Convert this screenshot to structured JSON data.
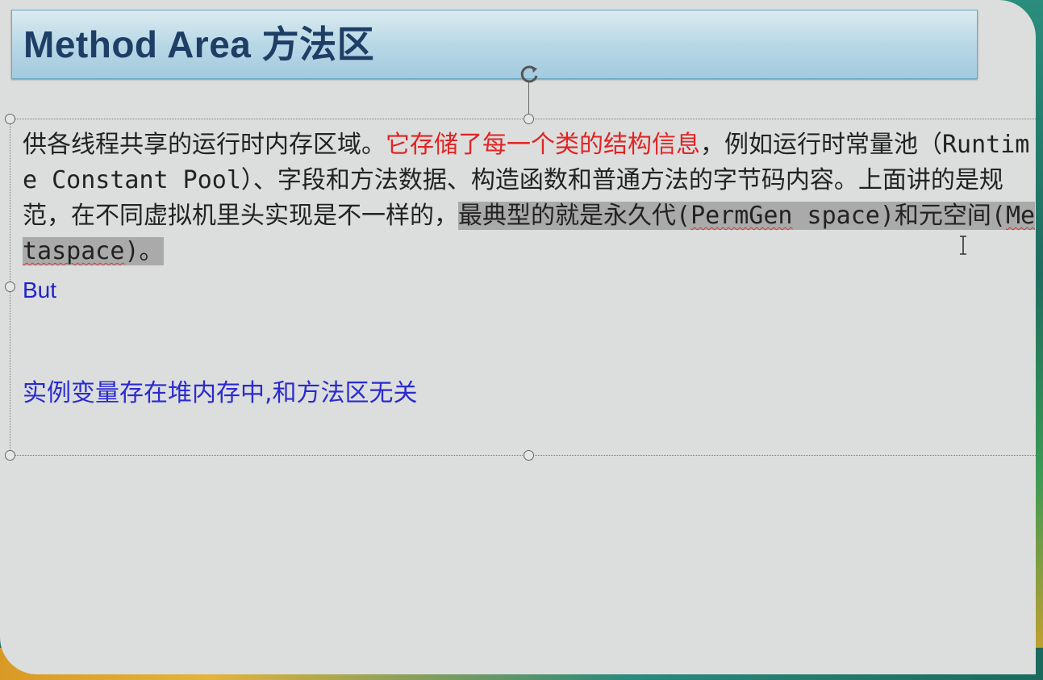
{
  "slide": {
    "title": "Method Area 方法区",
    "paragraph": {
      "part1": "供各线程共享的运行时内存区域。",
      "part2_red": "它存储了每一个类的结构信息",
      "part3": "，例如运行时常量池（Runtime Constant Pool）、字段和方法数据、构造函数和普通方法的字节码内容。上面讲的是规范，在不同虚拟机里头实现是不一样的，",
      "part4_highlight_a": "最典型的就是永久代(",
      "part4_highlight_permgen": "PermGen",
      "part4_highlight_b": " space)和元空间(",
      "part4_highlight_metaspace": "Metaspace",
      "part4_highlight_c": ")。"
    },
    "but_text": "But",
    "note_text": "实例变量存在堆内存中,和方法区无关"
  },
  "colors": {
    "title_text": "#1e3e66",
    "emphasis_red": "#e02424",
    "blue_text": "#2222cc",
    "highlight": "#a9aaa9"
  },
  "icons": {
    "rotate": "rotate-handle-icon",
    "cursor": "text-cursor-ibeam-icon"
  }
}
